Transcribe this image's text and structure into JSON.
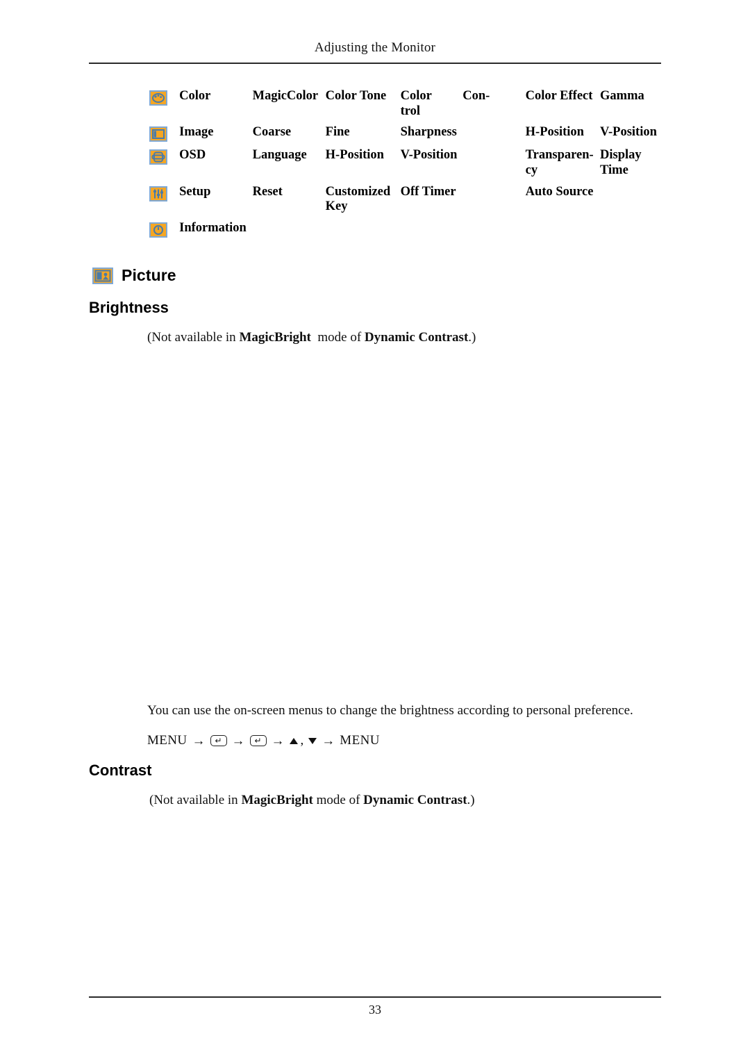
{
  "header": {
    "running_title": "Adjusting the Monitor",
    "page_number": "33"
  },
  "menu_table": {
    "rows": [
      {
        "icon": "color-palette-icon",
        "name": "Color",
        "items": [
          "MagicColor",
          "Color Tone",
          "Color Con-trol",
          "Color Effect",
          "Gamma"
        ]
      },
      {
        "icon": "image-frame-icon",
        "name": "Image",
        "items": [
          "Coarse",
          "Fine",
          "Sharpness",
          "H-Position",
          "V-Position"
        ]
      },
      {
        "icon": "osd-screen-icon",
        "name": "OSD",
        "items": [
          "Language",
          "H-Position",
          "V-Position",
          "Transparen-cy",
          "Display Time"
        ]
      },
      {
        "icon": "setup-sliders-icon",
        "name": "Setup",
        "items": [
          "Reset",
          "Customized Key",
          "Off Timer",
          "Auto Source",
          ""
        ]
      },
      {
        "icon": "information-clock-icon",
        "name": "Information",
        "items": [
          "",
          "",
          "",
          "",
          ""
        ]
      }
    ],
    "cells": {
      "color": {
        "c1": "MagicColor",
        "c2": "Color Tone",
        "c3a": "Color",
        "c3b": "trol",
        "c4": "Con-",
        "c5": "Color Effect",
        "c6": "Gamma"
      },
      "image": {
        "c1": "Coarse",
        "c2": "Fine",
        "c3": "Sharpness",
        "c5": "H-Position",
        "c6": "V-Position"
      },
      "osd": {
        "c1": "Language",
        "c2": "H-Position",
        "c3": "V-Position",
        "c5a": "Transparen-",
        "c5b": "cy",
        "c6": "Display Time"
      },
      "setup": {
        "c1": "Reset",
        "c2a": "Customized",
        "c2b": "Key",
        "c3": "Off Timer",
        "c5": "Auto Source"
      }
    }
  },
  "sections": {
    "picture": {
      "heading": "Picture",
      "icon": "picture-thumbnail-icon"
    },
    "brightness": {
      "heading": "Brightness",
      "note_prefix": "(Not available in ",
      "note_bold_1": "MagicBright",
      "note_middle": " mode of ",
      "note_bold_2": "Dynamic Contrast",
      "note_suffix": ".)",
      "body": "You can use the on-screen menus to change the brightness according to personal preference."
    },
    "contrast": {
      "heading": "Contrast",
      "note_prefix": "(Not available in ",
      "note_bold_1": "MagicBright",
      "note_middle": " mode of ",
      "note_bold_2": "Dynamic Contrast",
      "note_suffix": ".)"
    }
  },
  "nav_path": {
    "start": "MENU",
    "arrow": "→",
    "key_glyph": "↵",
    "comma": ",",
    "end": "MENU"
  },
  "colors": {
    "icon_background": "#f5a623",
    "icon_border": "#7fa8d4",
    "icon_detail": "#4a7ba8",
    "rule": "#2a2a2a",
    "text": "#111111"
  }
}
